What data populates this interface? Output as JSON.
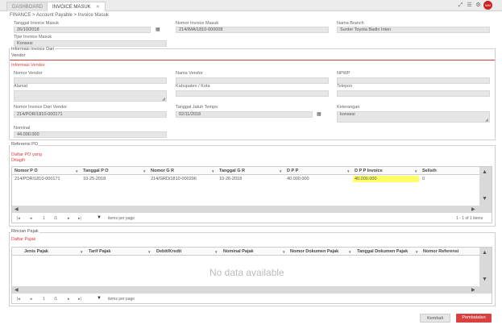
{
  "tabs": [
    {
      "label": "DASHBOARD"
    },
    {
      "label": "INVOICE MASUK"
    }
  ],
  "tab_close": "✕",
  "toolbar_icons": [
    "expand-icon",
    "list-icon",
    "settings-icon",
    "bell-icon"
  ],
  "avatar_text": "MM",
  "breadcrumb": "FINANCE > Account Payable > Invoice Masuk",
  "header": {
    "tanggal_invoice": {
      "label": "Tanggal Invoice Masuk",
      "value": "26/10/2018"
    },
    "nomor_invoice": {
      "label": "Nomor Invoice Masuk",
      "value": "214/IMA/1810-000008"
    },
    "nama_branch": {
      "label": "Nama Branch",
      "value": "Sunter Toyota Badin Inten"
    },
    "tipe_invoice": {
      "label": "Tipe Invoice Masuk",
      "value": "Konsesi"
    }
  },
  "info": {
    "title": "Informasi Invoice Dari",
    "vendor_label": "Vendor",
    "info_vendor": "Informasi Vendor",
    "nomor_vendor": {
      "label": "Nomor Vendor",
      "value": ""
    },
    "nama_vendor": {
      "label": "Nama Vendor",
      "value": ""
    },
    "npwp": {
      "label": "NPWP",
      "value": ""
    },
    "alamat": {
      "label": "Alamat",
      "value": ""
    },
    "kabupaten": {
      "label": "Kabupaten / Kota",
      "value": ""
    },
    "telepon": {
      "label": "Telepon",
      "value": ""
    },
    "nomor_inv_vendor": {
      "label": "Nomor Invoice Dari Vendor",
      "value": "214/POR/1810-000171"
    },
    "jatuh_tempo": {
      "label": "Tanggal Jatuh Tempo",
      "value": "02/11/2018"
    },
    "keterangan": {
      "label": "Keterangan",
      "value": "konsesi"
    },
    "nominal": {
      "label": "Nominal",
      "value": "44.000.000"
    }
  },
  "po": {
    "title": "Referensi PO",
    "daftar_line1": "Daftar PO yang",
    "daftar_line2": "Ditagih",
    "columns": [
      "Nomor P O",
      "Tanggal P O",
      "Nomor G R",
      "Tanggal G R",
      "D P P",
      "D P P Invoice",
      "Selisih"
    ],
    "rows": [
      [
        "214/POR/1810-000171",
        "10-25-2018",
        "214/GRD/1810-000296",
        "10-26-2018",
        "40.000.000",
        "40.000.000",
        "0"
      ]
    ],
    "pager": {
      "first": "|◂",
      "prev": "◂",
      "page": "1",
      "of": "/1",
      "next": "▸",
      "last": "▸|",
      "size_arrow": "▼",
      "items_per_page": "items per page",
      "range": "1 - 1 of 1 items"
    }
  },
  "pajak": {
    "title": "Rincian Pajak",
    "daftar": "Daftar Pajak",
    "columns": [
      "Jenis Pajak",
      "Tarif Pajak",
      "Debit/Kredit",
      "Nominal Pajak",
      "Nomor Dokumen Pajak",
      "Tanggal Dokumen Pajak",
      "Nomor Referensi"
    ],
    "nodata": "No data available",
    "pager": {
      "first": "|◂",
      "prev": "◂",
      "page": "1",
      "of": "/1",
      "next": "▸",
      "last": "▸|",
      "size_arrow": "▼",
      "items_per_page": "items per page"
    }
  },
  "buttons": {
    "kembali": "Kembali",
    "pembatalan": "Pembatalan"
  },
  "colors": {
    "accent": "#d94040",
    "highlight": "#ffff66"
  }
}
